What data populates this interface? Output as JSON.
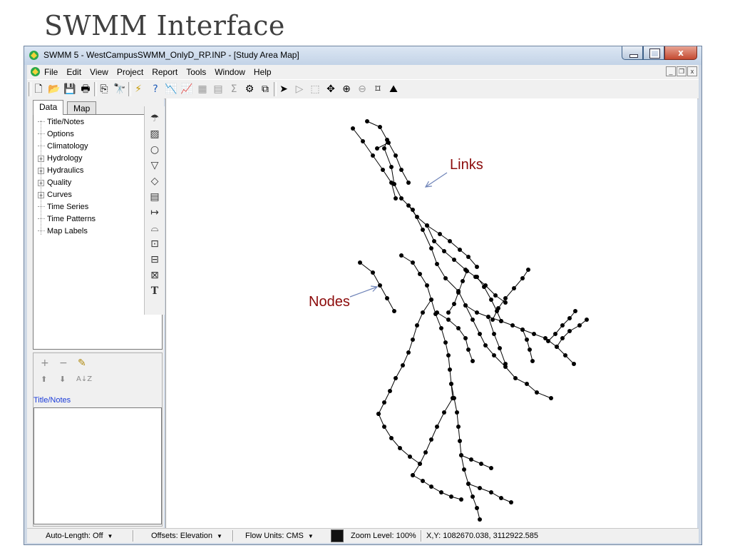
{
  "slide": {
    "title": "SWMM Interface"
  },
  "window": {
    "title": "SWMM 5 - WestCampusSWMM_OnlyD_RP.INP - [Study Area Map]",
    "close_label": "x"
  },
  "menu": {
    "items": [
      "File",
      "Edit",
      "View",
      "Project",
      "Report",
      "Tools",
      "Window",
      "Help"
    ]
  },
  "mdi": {
    "min": "_",
    "restore": "❐",
    "close": "x"
  },
  "toolbar": {
    "icons": [
      "new-icon",
      "open-icon",
      "save-icon",
      "print-icon",
      "copy-icon",
      "find-icon",
      "run-icon",
      "query-icon",
      "profile-icon",
      "time-series-icon",
      "scatter-icon",
      "table-icon",
      "statistics-icon",
      "options-icon",
      "arrange-icon",
      "select-icon",
      "vertex-select-icon",
      "region-select-icon",
      "pan-icon",
      "zoom-in-icon",
      "zoom-out-icon",
      "full-extent-icon",
      "measure-icon"
    ],
    "glyphs": [
      "🗋",
      "📂",
      "💾",
      "🖶",
      "⎘",
      "🔭",
      "⚡",
      "?",
      "📉",
      "📈",
      "▦",
      "▤",
      "Σ",
      "⚙",
      "⧉",
      "➤",
      "▷",
      "⬚",
      "✥",
      "⊕",
      "⊖",
      "⌑",
      "⛰"
    ]
  },
  "tabs": {
    "data": "Data",
    "map": "Map"
  },
  "tree": {
    "items": [
      {
        "label": "Title/Notes",
        "expandable": false
      },
      {
        "label": "Options",
        "expandable": false
      },
      {
        "label": "Climatology",
        "expandable": false
      },
      {
        "label": "Hydrology",
        "expandable": true
      },
      {
        "label": "Hydraulics",
        "expandable": true
      },
      {
        "label": "Quality",
        "expandable": true
      },
      {
        "label": "Curves",
        "expandable": true
      },
      {
        "label": "Time Series",
        "expandable": false
      },
      {
        "label": "Time Patterns",
        "expandable": false
      },
      {
        "label": "Map Labels",
        "expandable": false
      }
    ],
    "expand_glyph": "+"
  },
  "item_buttons": {
    "add": "+",
    "delete": "−",
    "edit": "✎",
    "up": "⬆",
    "down": "⬇",
    "sort": "A↓Z"
  },
  "selected_item": "Title/Notes",
  "object_toolbar": {
    "icons": [
      "rain-gage-icon",
      "subcatchment-icon",
      "junction-icon",
      "outfall-icon",
      "divider-icon",
      "storage-icon",
      "conduit-icon",
      "pump-icon",
      "orifice-icon",
      "weir-icon",
      "outlet-icon",
      "label-icon"
    ],
    "glyphs": [
      "☂",
      "▨",
      "○",
      "▽",
      "◇",
      "▤",
      "↦",
      "⌓",
      "⊡",
      "⊟",
      "⊠",
      "T"
    ]
  },
  "map": {
    "annotations": {
      "links": "Links",
      "nodes": "Nodes"
    },
    "colors": {
      "network": "#000000",
      "annotation": "#8b0a0a",
      "arrow": "#6f84b8"
    }
  },
  "status": {
    "auto_length": "Auto-Length: Off",
    "offsets": "Offsets: Elevation",
    "flow_units": "Flow Units: CMS",
    "zoom": "Zoom Level: 100%",
    "xy": "X,Y: 1082670.038, 3112922.585",
    "dropdown_glyph": "▼"
  }
}
